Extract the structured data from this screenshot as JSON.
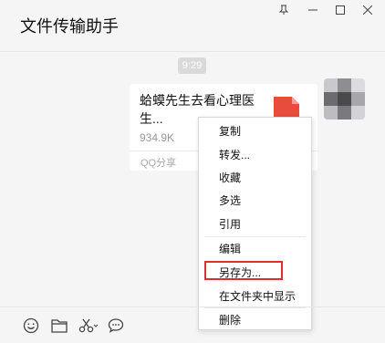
{
  "window": {
    "title": "文件传输助手",
    "controls": [
      "pin-icon",
      "minimize-icon",
      "maximize-icon",
      "close-icon"
    ]
  },
  "chat": {
    "timestamp": "9:29",
    "file_message": {
      "name": "蛤蟆先生去看心理医生...",
      "size": "934.9K",
      "source": "QQ分享",
      "icon": "pdf-file-icon",
      "icon_color": "#e84c3d"
    }
  },
  "context_menu": {
    "items": [
      {
        "label": "复制"
      },
      {
        "label": "转发..."
      },
      {
        "label": "收藏"
      },
      {
        "label": "多选"
      },
      {
        "label": "引用"
      },
      {
        "label": "编辑"
      },
      {
        "label": "另存为..."
      },
      {
        "label": "在文件夹中显示"
      },
      {
        "label": "删除"
      }
    ],
    "highlighted_item": "另存为...",
    "highlight_color": "#d9312b"
  },
  "toolbar": {
    "icons": [
      "emoji-icon",
      "folder-icon",
      "scissors-icon",
      "chat-bubble-icon"
    ]
  }
}
